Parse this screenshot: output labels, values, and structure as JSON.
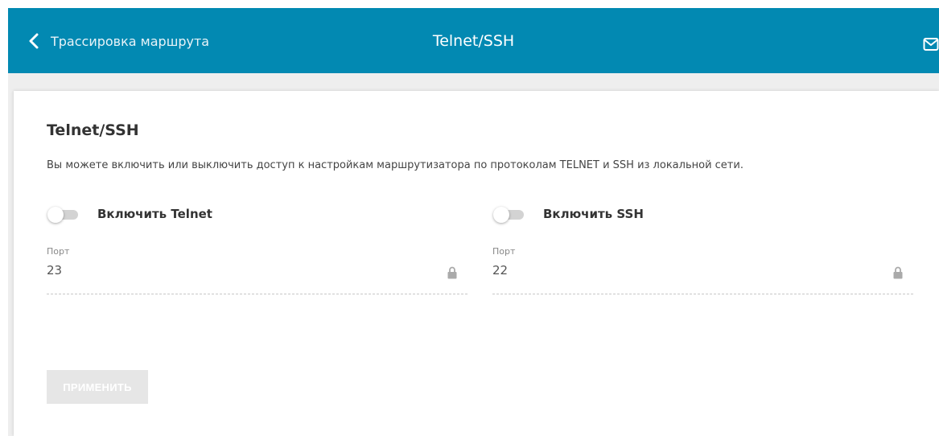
{
  "header": {
    "back_label": "Трассировка маршрута",
    "title": "Telnet/SSH",
    "mail_icon": "mail-icon",
    "color": "#0289b2"
  },
  "section": {
    "heading": "Telnet/SSH",
    "description": "Вы можете включить или выключить доступ к настройкам маршрутизатора по протоколам TELNET и SSH из локальной сети."
  },
  "telnet": {
    "toggle_label": "Включить Telnet",
    "enabled": false,
    "port_label": "Порт",
    "port_value": "23"
  },
  "ssh": {
    "toggle_label": "Включить SSH",
    "enabled": false,
    "port_label": "Порт",
    "port_value": "22"
  },
  "actions": {
    "apply_label": "ПРИМЕНИТЬ"
  }
}
